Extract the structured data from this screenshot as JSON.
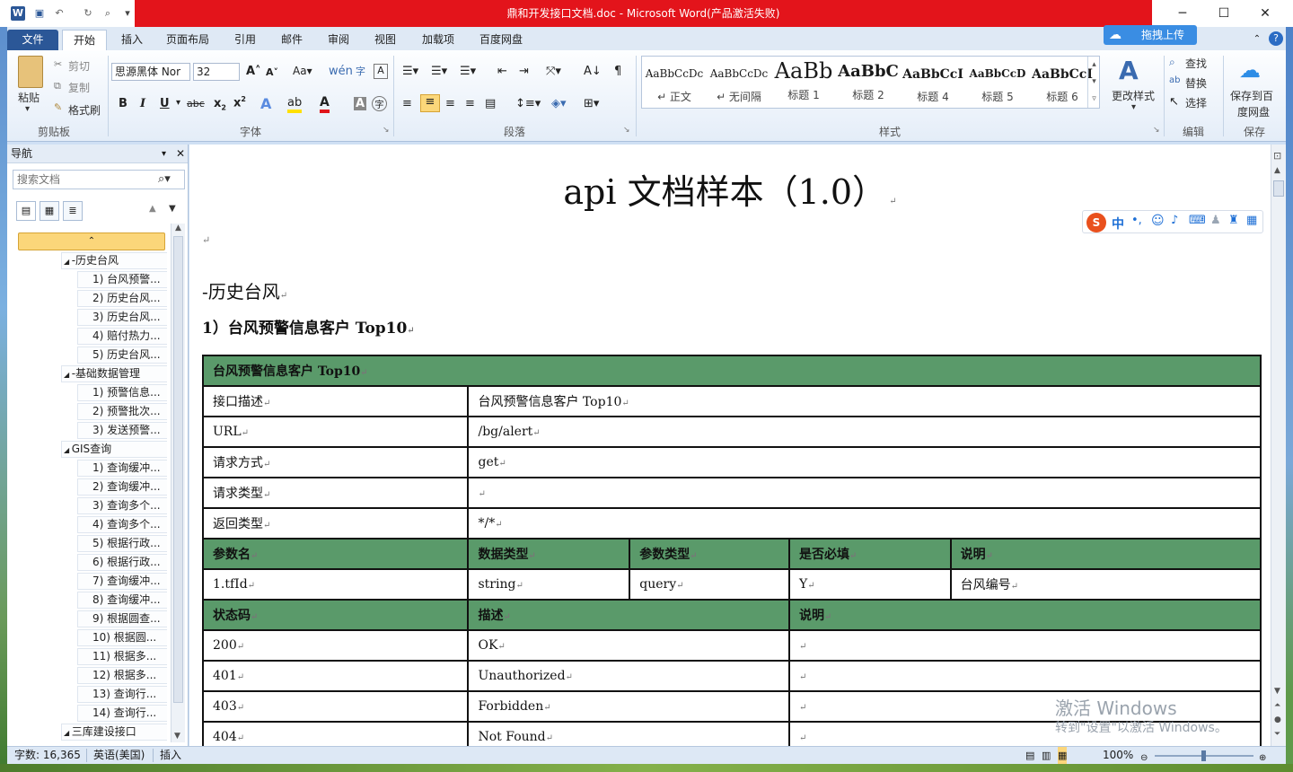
{
  "window": {
    "title": "鼎和开发接口文档.doc - Microsoft Word(产品激活失败)"
  },
  "tabs": [
    "文件",
    "开始",
    "插入",
    "页面布局",
    "引用",
    "邮件",
    "审阅",
    "视图",
    "加载项",
    "百度网盘"
  ],
  "upload_label": "拖拽上传",
  "clipboard": {
    "paste": "粘贴",
    "cut": "剪切",
    "copy": "复制",
    "format_painter": "格式刷",
    "group": "剪贴板"
  },
  "font": {
    "name": "思源黑体 Nor",
    "size": "32",
    "group": "字体"
  },
  "paragraph": {
    "group": "段落"
  },
  "styles": {
    "group": "样式",
    "change": "更改样式",
    "items": [
      {
        "preview": "AaBbCcDc",
        "name": "↵ 正文"
      },
      {
        "preview": "AaBbCcDc",
        "name": "↵ 无间隔"
      },
      {
        "preview": "AaBb",
        "name": "标题 1"
      },
      {
        "preview": "AaBbC",
        "name": "标题 2"
      },
      {
        "preview": "AaBbCcI",
        "name": "标题 4"
      },
      {
        "preview": "AaBbCcD",
        "name": "标题 5"
      },
      {
        "preview": "AaBbCcI",
        "name": "标题 6"
      }
    ]
  },
  "editing": {
    "find": "查找",
    "replace": "替换",
    "select": "选择",
    "group": "编辑"
  },
  "save": {
    "label1": "保存到百",
    "label2": "度网盘",
    "group": "保存"
  },
  "nav": {
    "title": "导航",
    "search_placeholder": "搜索文档",
    "nodes": [
      {
        "label": "-历史台风",
        "level": 1
      },
      {
        "label": "1) 台风预警...",
        "level": 2
      },
      {
        "label": "2) 历史台风...",
        "level": 2
      },
      {
        "label": "3) 历史台风...",
        "level": 2
      },
      {
        "label": "4) 赔付热力...",
        "level": 2
      },
      {
        "label": "5) 历史台风...",
        "level": 2
      },
      {
        "label": "-基础数据管理",
        "level": 1
      },
      {
        "label": "1) 预警信息...",
        "level": 2
      },
      {
        "label": "2) 预警批次...",
        "level": 2
      },
      {
        "label": "3) 发送预警...",
        "level": 2
      },
      {
        "label": "GIS查询",
        "level": 1
      },
      {
        "label": "1) 查询缓冲...",
        "level": 2
      },
      {
        "label": "2) 查询缓冲...",
        "level": 2
      },
      {
        "label": "3) 查询多个...",
        "level": 2
      },
      {
        "label": "4) 查询多个...",
        "level": 2
      },
      {
        "label": "5) 根据行政...",
        "level": 2
      },
      {
        "label": "6) 根据行政...",
        "level": 2
      },
      {
        "label": "7) 查询缓冲...",
        "level": 2
      },
      {
        "label": "8) 查询缓冲...",
        "level": 2
      },
      {
        "label": "9) 根据圆查...",
        "level": 2
      },
      {
        "label": "10) 根据圆...",
        "level": 2
      },
      {
        "label": "11) 根据多...",
        "level": 2
      },
      {
        "label": "12) 根据多...",
        "level": 2
      },
      {
        "label": "13) 查询行...",
        "level": 2
      },
      {
        "label": "14) 查询行...",
        "level": 2
      },
      {
        "label": "三库建设接口",
        "level": 1
      }
    ]
  },
  "doc": {
    "title": "api 文档样本（1.0）",
    "h1": "-历史台风",
    "h2": "1）台风预警信息客户 Top10",
    "table_title": "台风预警信息客户 Top10",
    "info_rows": [
      [
        "接口描述",
        "台风预警信息客户 Top10"
      ],
      [
        "URL",
        "/bg/alert"
      ],
      [
        "请求方式",
        "get"
      ],
      [
        "请求类型",
        ""
      ],
      [
        "返回类型",
        "*/*"
      ]
    ],
    "param_header": [
      "参数名",
      "数据类型",
      "参数类型",
      "是否必填",
      "说明"
    ],
    "param_rows": [
      [
        "1.tfId",
        "string",
        "query",
        "Y",
        "台风编号"
      ]
    ],
    "status_header": [
      "状态码",
      "描述",
      "说明"
    ],
    "status_rows": [
      [
        "200",
        "OK",
        ""
      ],
      [
        "401",
        "Unauthorized",
        ""
      ],
      [
        "403",
        "Forbidden",
        ""
      ],
      [
        "404",
        "Not Found",
        ""
      ]
    ]
  },
  "status": {
    "words": "字数: 16,365",
    "lang": "英语(美国)",
    "mode": "插入",
    "zoom": "100%"
  },
  "watermark": {
    "line1": "激活 Windows",
    "line2": "转到\"设置\"以激活 Windows。"
  },
  "ime": {
    "lang": "中"
  }
}
